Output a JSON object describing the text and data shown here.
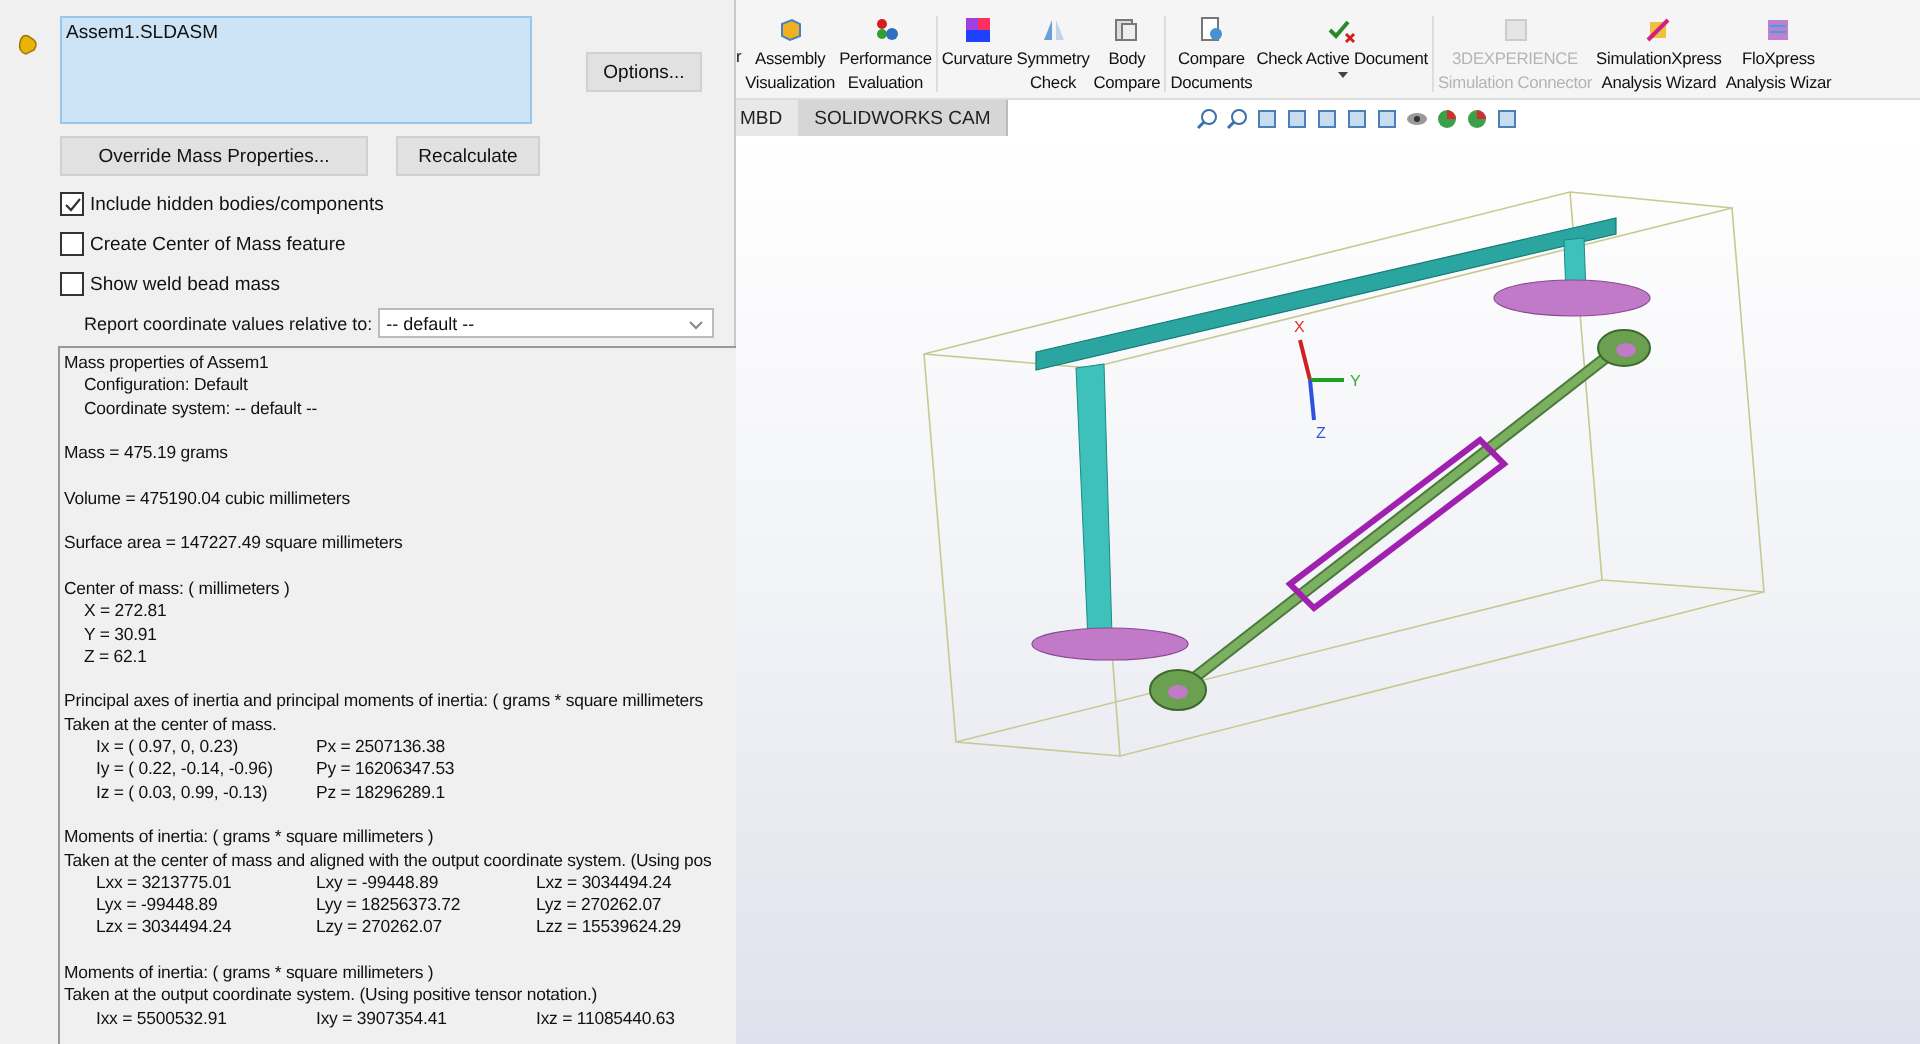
{
  "selection": {
    "value": "Assem1.SLDASM"
  },
  "buttons": {
    "options": "Options...",
    "override": "Override Mass Properties...",
    "recalculate": "Recalculate"
  },
  "checkboxes": [
    {
      "label": "Include hidden bodies/components",
      "checked": true
    },
    {
      "label": "Create Center of Mass feature",
      "checked": false
    },
    {
      "label": "Show weld bead mass",
      "checked": false
    }
  ],
  "coordinate_select": {
    "label": "Report coordinate values relative to:",
    "value": "-- default --"
  },
  "report": [
    {
      "lines": [
        "Mass properties of Assem1"
      ],
      "sub": [
        "Configuration: Default",
        "Coordinate system: -- default --"
      ]
    },
    {
      "lines": [
        "Mass = 475.19 grams"
      ]
    },
    {
      "lines": [
        "Volume = 475190.04 cubic millimeters"
      ]
    },
    {
      "lines": [
        "Surface area = 147227.49  square millimeters"
      ]
    },
    {
      "lines": [
        "Center of mass: ( millimeters )"
      ],
      "sub": [
        "X = 272.81",
        "Y = 30.91",
        "Z = 62.1"
      ]
    },
    {
      "lines": [
        "Principal axes of inertia and principal moments of inertia: ( grams *  square millimeters",
        "Taken at the center of mass."
      ],
      "grid": [
        [
          "Ix = ( 0.97,  0,  0.23)",
          "Px = 2507136.38"
        ],
        [
          "Iy = ( 0.22, -0.14, -0.96)",
          "Py = 16206347.53"
        ],
        [
          "Iz = ( 0.03,  0.99, -0.13)",
          "Pz = 18296289.1"
        ]
      ]
    },
    {
      "lines": [
        "Moments of inertia: ( grams *  square millimeters )",
        "Taken at the center of mass and aligned with the output coordinate system. (Using pos"
      ],
      "grid": [
        [
          "Lxx = 3213775.01",
          "Lxy = -99448.89",
          "Lxz = 3034494.24"
        ],
        [
          "Lyx = -99448.89",
          "Lyy = 18256373.72",
          "Lyz = 270262.07"
        ],
        [
          "Lzx = 3034494.24",
          "Lzy = 270262.07",
          "Lzz = 15539624.29"
        ]
      ]
    },
    {
      "lines": [
        "Moments of inertia: ( grams *  square millimeters )",
        "Taken at the output coordinate system. (Using positive tensor notation.)"
      ],
      "grid": [
        [
          "Ixx = 5500532.91",
          "Ixy = 3907354.41",
          "Ixz = 11085440.63"
        ]
      ]
    }
  ],
  "toolbar": [
    {
      "label": [
        "r"
      ],
      "disabled": false
    },
    {
      "label": [
        "Assembly",
        "Visualization"
      ],
      "disabled": false
    },
    {
      "label": [
        "Performance",
        "Evaluation"
      ],
      "disabled": false
    },
    {
      "label": [
        "Curvature"
      ],
      "disabled": false
    },
    {
      "label": [
        "Symmetry",
        "Check"
      ],
      "disabled": false
    },
    {
      "label": [
        "Body",
        "Compare"
      ],
      "disabled": false
    },
    {
      "label": [
        "Compare",
        "Documents"
      ],
      "disabled": false
    },
    {
      "label": [
        "Check Active Document"
      ],
      "disabled": false,
      "dropdown": true
    },
    {
      "label": [
        "3DEXPERIENCE",
        "Simulation Connector"
      ],
      "disabled": true
    },
    {
      "label": [
        "SimulationXpress",
        "Analysis Wizard"
      ],
      "disabled": false
    },
    {
      "label": [
        "FloXpress",
        "Analysis Wizar"
      ],
      "disabled": false
    }
  ],
  "tabs": [
    {
      "label": "MBD",
      "selected": false
    },
    {
      "label": "SOLIDWORKS CAM",
      "selected": true
    }
  ],
  "triad_labels": [
    "X",
    "Y",
    "Z"
  ]
}
